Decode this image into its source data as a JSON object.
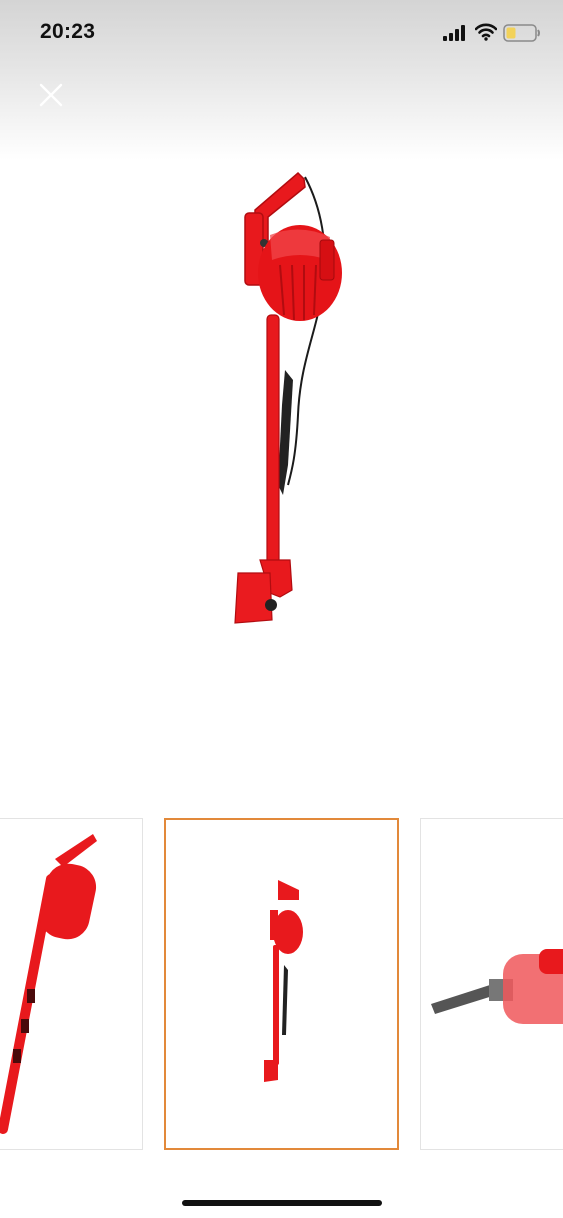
{
  "status_bar": {
    "time": "20:23",
    "signal_icon": "cellular-signal-icon",
    "wifi_icon": "wifi-icon",
    "battery_icon": "battery-icon"
  },
  "viewer": {
    "close_icon": "close-icon",
    "main_image": "red-stick-vacuum-cleaner-product-photo",
    "thumbnails": [
      {
        "image": "red-stick-vacuum-angled-view",
        "selected": false
      },
      {
        "image": "red-stick-vacuum-upright-view",
        "selected": true
      },
      {
        "image": "handheld-vacuum-with-crevice-tool",
        "selected": false
      }
    ]
  },
  "colors": {
    "product_red": "#e8191d",
    "selected_border": "#e2893a",
    "accent_dark": "#111111"
  }
}
